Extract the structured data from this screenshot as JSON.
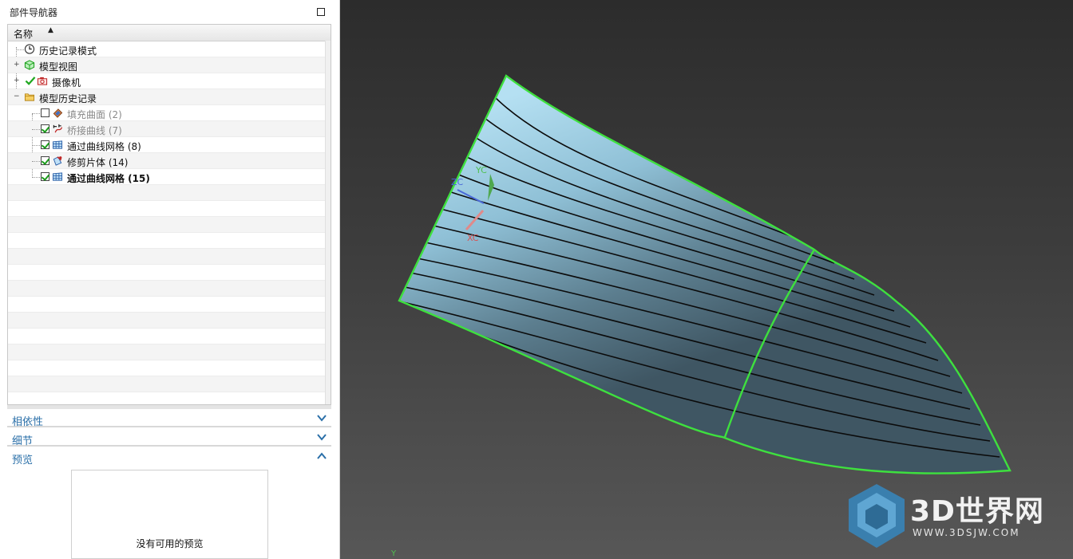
{
  "navigator": {
    "title": "部件导航器",
    "column_name": "名称",
    "items": [
      {
        "label": "历史记录模式",
        "icon": "clock-icon",
        "checked": null,
        "expander": ""
      },
      {
        "label": "模型视图",
        "icon": "model-views-icon",
        "checked": null,
        "expander": "+"
      },
      {
        "label": "摄像机",
        "icon": "camera-icon",
        "checked": null,
        "expander": "+"
      },
      {
        "label": "模型历史记录",
        "icon": "folder-icon",
        "checked": null,
        "expander": "−"
      },
      {
        "label": "填充曲面 (2)",
        "icon": "fill-surface-icon",
        "checked": false,
        "disabled": true
      },
      {
        "label": "桥接曲线 (7)",
        "icon": "bridge-curve-icon",
        "checked": true,
        "disabled": true
      },
      {
        "label": "通过曲线网格 (8)",
        "icon": "curve-mesh-icon",
        "checked": true
      },
      {
        "label": "修剪片体 (14)",
        "icon": "trim-sheet-icon",
        "checked": true
      },
      {
        "label": "通过曲线网格 (15)",
        "icon": "curve-mesh-icon",
        "checked": true,
        "bold": true
      }
    ]
  },
  "panels": {
    "dependencies": "相依性",
    "details": "细节",
    "preview": "预览",
    "preview_empty": "没有可用的预览"
  },
  "viewport": {
    "axis_labels": {
      "yc": "YC",
      "zc": "ZC",
      "xc": "XC",
      "y": "Y"
    },
    "watermark": {
      "title": "3D世界网",
      "url": "WWW.3DSJW.COM"
    },
    "colors": {
      "edge": "#3ee03e",
      "surface_light": "#a6d6ec",
      "surface_dark": "#3f5663",
      "background": "#3a3a3a"
    }
  }
}
